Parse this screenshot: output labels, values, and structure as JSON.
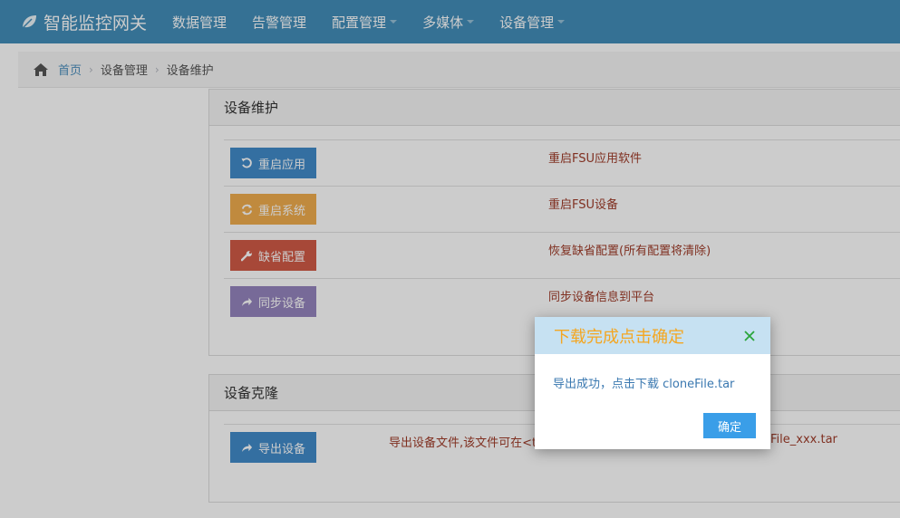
{
  "navbar": {
    "brand": "智能监控网关",
    "items": [
      {
        "label": "数据管理",
        "has_caret": false
      },
      {
        "label": "告警管理",
        "has_caret": false
      },
      {
        "label": "配置管理",
        "has_caret": true
      },
      {
        "label": "多媒体",
        "has_caret": true
      },
      {
        "label": "设备管理",
        "has_caret": true
      }
    ]
  },
  "breadcrumb": {
    "home": "首页",
    "level1": "设备管理",
    "level2": "设备维护"
  },
  "maintenance": {
    "title": "设备维护",
    "rows": [
      {
        "button": "重启应用",
        "desc": "重启FSU应用软件",
        "color": "#428bca",
        "icon": "undo-icon"
      },
      {
        "button": "重启系统",
        "desc": "重启FSU设备",
        "color": "#f0ad4e",
        "icon": "refresh-icon"
      },
      {
        "button": "缺省配置",
        "desc": "恢复缺省配置(所有配置将清除)",
        "color": "#d15b47",
        "icon": "wrench-icon"
      },
      {
        "button": "同步设备",
        "desc": "同步设备信息到平台",
        "color": "#9585bf",
        "icon": "share-icon"
      }
    ]
  },
  "clone": {
    "title": "设备克隆",
    "button": "导出设备",
    "desc_left": "导出设备文件,该文件可在<type",
    "desc_right": "File_xxx.tar"
  },
  "dialog": {
    "title": "下载完成点击确定",
    "message": "导出成功，点击下载 cloneFile.tar",
    "ok": "确定"
  },
  "colors": {
    "navbar": "#438eb9",
    "dialog_title": "#f4a621",
    "dialog_head": "#c6e1f2",
    "ok_button": "#3a9ee8",
    "desc_text": "#a03c2a"
  }
}
